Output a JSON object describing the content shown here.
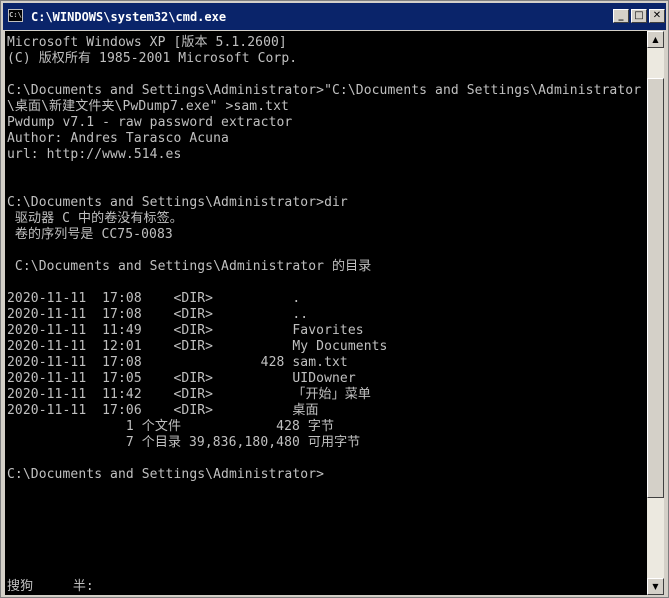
{
  "window": {
    "title": "C:\\WINDOWS\\system32\\cmd.exe",
    "icon_name": "cmd-icon",
    "icon_text": "C:\\"
  },
  "controls": {
    "minimize": "_",
    "maximize": "□",
    "close": "✕"
  },
  "scrollbar": {
    "up": "▲",
    "down": "▼"
  },
  "console": {
    "lines": [
      "Microsoft Windows XP [版本 5.1.2600]",
      "(C) 版权所有 1985-2001 Microsoft Corp.",
      "",
      "C:\\Documents and Settings\\Administrator>\"C:\\Documents and Settings\\Administrator",
      "\\桌面\\新建文件夹\\PwDump7.exe\" >sam.txt",
      "Pwdump v7.1 - raw password extractor",
      "Author: Andres Tarasco Acuna",
      "url: http://www.514.es",
      "",
      "",
      "C:\\Documents and Settings\\Administrator>dir",
      " 驱动器 C 中的卷没有标签。",
      " 卷的序列号是 CC75-0083",
      "",
      " C:\\Documents and Settings\\Administrator 的目录",
      "",
      "2020-11-11  17:08    <DIR>          .",
      "2020-11-11  17:08    <DIR>          ..",
      "2020-11-11  11:49    <DIR>          Favorites",
      "2020-11-11  12:01    <DIR>          My Documents",
      "2020-11-11  17:08               428 sam.txt",
      "2020-11-11  17:05    <DIR>          UIDowner",
      "2020-11-11  11:42    <DIR>          「开始」菜单",
      "2020-11-11  17:06    <DIR>          桌面",
      "               1 个文件            428 字节",
      "               7 个目录 39,836,180,480 可用字节",
      "",
      "C:\\Documents and Settings\\Administrator>",
      "",
      "",
      "",
      "",
      "",
      "",
      "搜狗     半:"
    ]
  }
}
